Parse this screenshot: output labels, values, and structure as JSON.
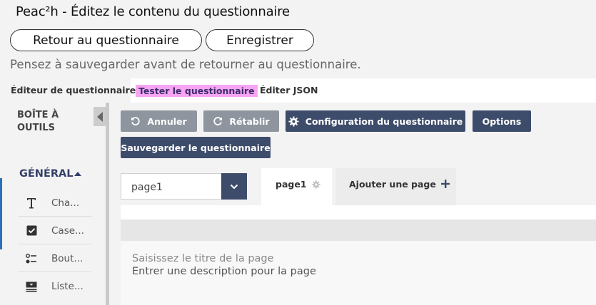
{
  "window": {
    "title": "Peac²h - Éditez le contenu du questionnaire"
  },
  "header": {
    "back_label": "Retour au questionnaire",
    "save_label": "Enregistrer",
    "hint": "Pensez à sauvegarder avant de retourner au questionnaire."
  },
  "tabs": [
    {
      "label": "Éditeur de questionnaire",
      "active": true
    },
    {
      "label": "Tester le questionnaire",
      "highlight": "#f7a4f2"
    },
    {
      "label": "Éditer JSON"
    }
  ],
  "toolbox": {
    "title": "BOÎTE À OUTILS",
    "section": "GÉNÉRAL",
    "items": [
      {
        "label": "Cha...",
        "icon": "text-icon"
      },
      {
        "label": "Case...",
        "icon": "checkbox-icon"
      },
      {
        "label": "Bout...",
        "icon": "radio-list-icon"
      },
      {
        "label": "Liste...",
        "icon": "dropdown-list-icon"
      }
    ]
  },
  "actions": {
    "undo": "Annuler",
    "redo": "Rétablir",
    "config": "Configuration du questionnaire",
    "options": "Options",
    "save_survey": "Sauvegarder le questionnaire"
  },
  "pages": {
    "selected": "page1",
    "tab_label": "page1",
    "add_label": "Ajouter une page"
  },
  "page": {
    "title_placeholder": "Saisissez le titre de la page",
    "description_placeholder": "Entrer une description pour la page"
  },
  "colors": {
    "dark_button": "#3e4c6b",
    "grey_button": "#8e959e",
    "test_tab_highlight": "#f7a4f2",
    "section_label": "#34406a"
  }
}
